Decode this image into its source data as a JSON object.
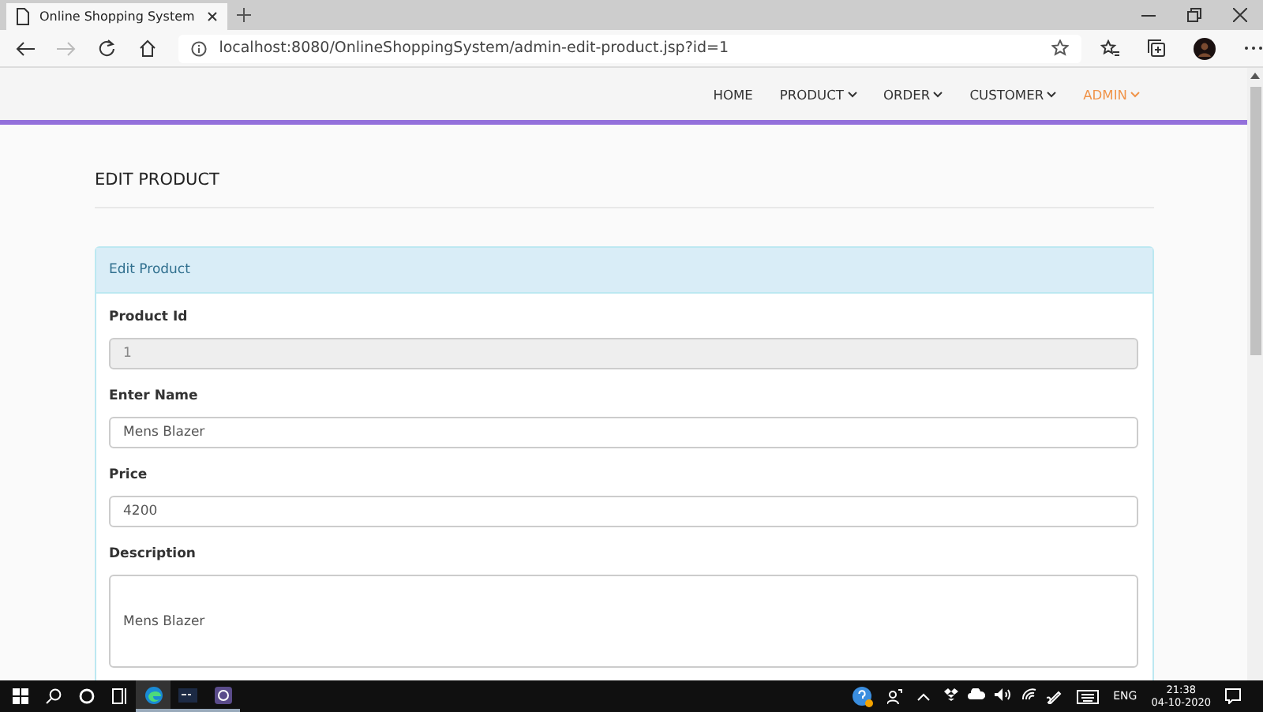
{
  "browser": {
    "tab_title": "Online Shopping System",
    "url": "localhost:8080/OnlineShoppingSystem/admin-edit-product.jsp?id=1"
  },
  "nav": [
    {
      "label": "HOME",
      "dropdown": false,
      "selected": false
    },
    {
      "label": "PRODUCT",
      "dropdown": true,
      "selected": false
    },
    {
      "label": "ORDER",
      "dropdown": true,
      "selected": false
    },
    {
      "label": "CUSTOMER",
      "dropdown": true,
      "selected": false
    },
    {
      "label": "ADMIN",
      "dropdown": true,
      "selected": true
    }
  ],
  "heading": "EDIT PRODUCT",
  "panel": {
    "title": "Edit Product",
    "fields": [
      {
        "label": "Product Id",
        "kind": "input",
        "value": "1",
        "disabled": true
      },
      {
        "label": "Enter Name",
        "kind": "input",
        "value": "Mens Blazer",
        "disabled": false
      },
      {
        "label": "Price",
        "kind": "input",
        "value": "4200",
        "disabled": false
      },
      {
        "label": "Description",
        "kind": "textarea",
        "value": "Mens Blazer",
        "disabled": false
      }
    ]
  },
  "taskbar": {
    "language": "ENG",
    "time": "21:38",
    "date": "04-10-2020"
  }
}
